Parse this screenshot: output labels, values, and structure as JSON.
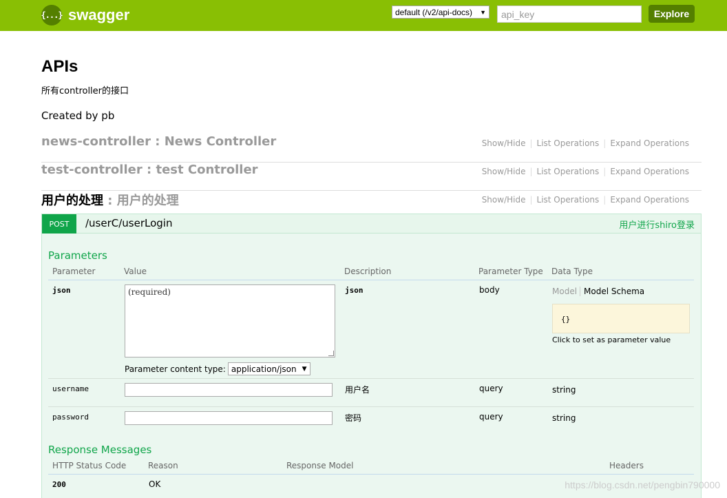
{
  "header": {
    "logo_glyph": "{...}",
    "logo_text": "swagger",
    "spec_select": "default (/v2/api-docs)",
    "api_key_placeholder": "api_key",
    "explore_label": "Explore",
    "bg_color": "#89bf04"
  },
  "info": {
    "title": "APIs",
    "description": "所有controller的接口",
    "created_by": "Created by pb"
  },
  "resources": [
    {
      "name": "news-controller",
      "sep": " : ",
      "desc": "News Controller"
    },
    {
      "name": "test-controller",
      "sep": " : ",
      "desc": "test Controller"
    },
    {
      "name": "用户的处理",
      "sep": " : ",
      "desc": "用户的处理"
    }
  ],
  "resource_ops": {
    "show_hide": "Show/Hide",
    "list_operations": "List Operations",
    "expand_operations": "Expand Operations"
  },
  "operation": {
    "method": "POST",
    "path": "/userC/userLogin",
    "summary": "用户进行shiro登录",
    "method_color": "#10a54a"
  },
  "parameters": {
    "title": "Parameters",
    "headers": {
      "parameter": "Parameter",
      "value": "Value",
      "description": "Description",
      "parameter_type": "Parameter Type",
      "data_type": "Data Type"
    },
    "rows": [
      {
        "name": "json",
        "value_placeholder": "(required)",
        "description": "json",
        "param_type": "body",
        "data_type": ""
      },
      {
        "name": "username",
        "value_placeholder": "",
        "description": "用户名",
        "param_type": "query",
        "data_type": "string"
      },
      {
        "name": "password",
        "value_placeholder": "",
        "description": "密码",
        "param_type": "query",
        "data_type": "string"
      }
    ],
    "content_type_label": "Parameter content type:",
    "content_type_value": "application/json",
    "model_tab": "Model",
    "model_schema_tab": "Model Schema",
    "model_schema_value": "{}",
    "model_hint": "Click to set as parameter value"
  },
  "responses": {
    "title": "Response Messages",
    "headers": {
      "status_code": "HTTP Status Code",
      "reason": "Reason",
      "response_model": "Response Model",
      "headers": "Headers"
    },
    "rows": [
      {
        "code": "200",
        "reason": "OK"
      }
    ]
  },
  "watermark": "https://blog.csdn.net/pengbin790000"
}
